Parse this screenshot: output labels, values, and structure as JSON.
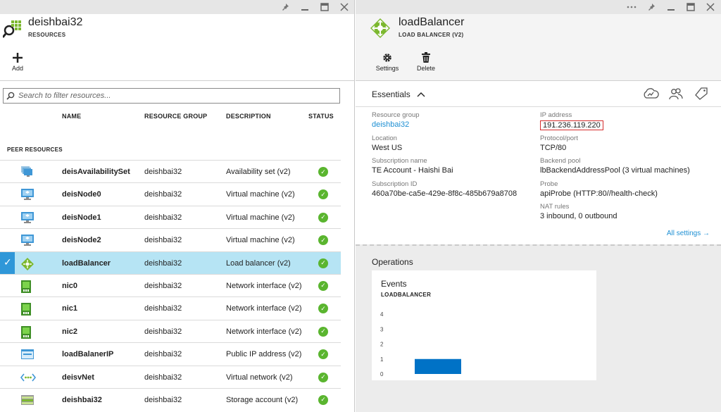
{
  "left_blade": {
    "title": "deishbai32",
    "subtitle": "RESOURCES",
    "add_label": "Add",
    "search_placeholder": "Search to filter resources...",
    "columns": [
      "NAME",
      "RESOURCE GROUP",
      "DESCRIPTION",
      "STATUS"
    ],
    "section_label": "PEER RESOURCES",
    "rows": [
      {
        "name": "deisAvailabilitySet",
        "group": "deishbai32",
        "desc": "Availability set (v2)",
        "icon": "availability-set-icon"
      },
      {
        "name": "deisNode0",
        "group": "deishbai32",
        "desc": "Virtual machine (v2)",
        "icon": "virtual-machine-icon"
      },
      {
        "name": "deisNode1",
        "group": "deishbai32",
        "desc": "Virtual machine (v2)",
        "icon": "virtual-machine-icon"
      },
      {
        "name": "deisNode2",
        "group": "deishbai32",
        "desc": "Virtual machine (v2)",
        "icon": "virtual-machine-icon"
      },
      {
        "name": "loadBalancer",
        "group": "deishbai32",
        "desc": "Load balancer (v2)",
        "icon": "load-balancer-icon",
        "selected": true
      },
      {
        "name": "nic0",
        "group": "deishbai32",
        "desc": "Network interface (v2)",
        "icon": "network-interface-icon"
      },
      {
        "name": "nic1",
        "group": "deishbai32",
        "desc": "Network interface (v2)",
        "icon": "network-interface-icon"
      },
      {
        "name": "nic2",
        "group": "deishbai32",
        "desc": "Network interface (v2)",
        "icon": "network-interface-icon"
      },
      {
        "name": "loadBalanerIP",
        "group": "deishbai32",
        "desc": "Public IP address (v2)",
        "icon": "public-ip-icon"
      },
      {
        "name": "deisvNet",
        "group": "deishbai32",
        "desc": "Virtual network (v2)",
        "icon": "virtual-network-icon"
      },
      {
        "name": "deishbai32",
        "group": "deishbai32",
        "desc": "Storage account (v2)",
        "icon": "storage-account-icon"
      }
    ]
  },
  "right_blade": {
    "title": "loadBalancer",
    "subtitle": "LOAD BALANCER (V2)",
    "settings_label": "Settings",
    "delete_label": "Delete",
    "essentials_label": "Essentials",
    "essentials": {
      "resource_group_label": "Resource group",
      "resource_group": "deishbai32",
      "location_label": "Location",
      "location": "West US",
      "subscription_name_label": "Subscription name",
      "subscription_name": "TE Account - Haishi Bai",
      "subscription_id_label": "Subscription ID",
      "subscription_id": "460a70be-ca5e-429e-8f8c-485b679a8708",
      "ip_address_label": "IP address",
      "ip_address": "191.236.119.220",
      "protocol_label": "Protocol/port",
      "protocol": "TCP/80",
      "backend_pool_label": "Backend pool",
      "backend_pool": "lbBackendAddressPool (3 virtual machines)",
      "probe_label": "Probe",
      "probe": "apiProbe (HTTP:80//health-check)",
      "nat_rules_label": "NAT rules",
      "nat_rules": "3 inbound, 0 outbound"
    },
    "all_settings_label": "All settings →",
    "operations_label": "Operations",
    "events_tile": {
      "title": "Events",
      "subtitle": "LOADBALANCER"
    }
  },
  "colors": {
    "accent": "#1d8fd3",
    "selected_row": "#b6e4f4",
    "status_ok": "#5ab52f",
    "bar": "#0072c6"
  },
  "chart_data": {
    "type": "bar",
    "categories": [
      ""
    ],
    "values": [
      1
    ],
    "ylim": [
      0,
      4
    ],
    "yticks": [
      0,
      1,
      2,
      3,
      4
    ],
    "title": "",
    "xlabel": "",
    "ylabel": ""
  }
}
